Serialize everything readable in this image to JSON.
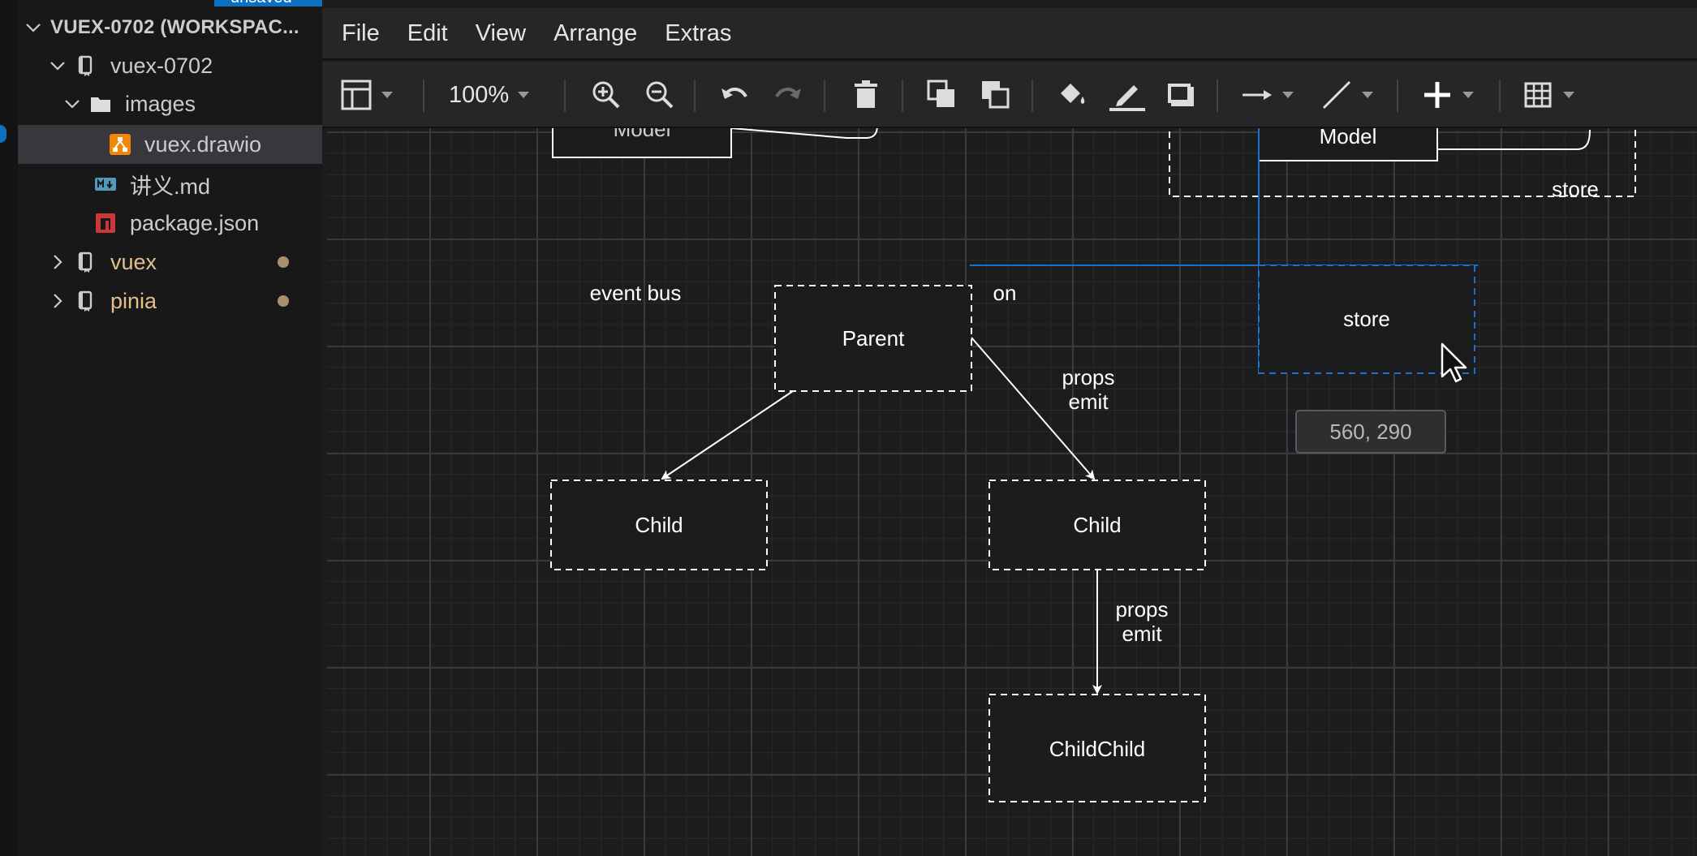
{
  "sidebar": {
    "unsaved_label": "unsaved",
    "workspace_title": "VUEX-0702 (WORKSPAC...",
    "items": [
      {
        "label": "vuex-0702",
        "type": "repo",
        "expanded": true
      },
      {
        "label": "images",
        "type": "folder",
        "expanded": true
      },
      {
        "label": "vuex.drawio",
        "type": "drawio-file",
        "selected": true
      },
      {
        "label": "讲义.md",
        "type": "markdown-file"
      },
      {
        "label": "package.json",
        "type": "npm-file"
      },
      {
        "label": "vuex",
        "type": "repo",
        "expanded": false,
        "modified": true
      },
      {
        "label": "pinia",
        "type": "repo",
        "expanded": false,
        "modified": true
      }
    ]
  },
  "menu": {
    "items": [
      "File",
      "Edit",
      "View",
      "Arrange",
      "Extras"
    ]
  },
  "toolbar": {
    "zoom": "100%",
    "tools": [
      "format-panel-icon",
      "zoom-in-icon",
      "zoom-out-icon",
      "undo-icon",
      "redo-icon",
      "delete-icon",
      "to-front-icon",
      "to-back-icon",
      "fill-color-icon",
      "line-color-icon",
      "shadow-icon",
      "connection-icon",
      "waypoints-icon",
      "insert-icon",
      "table-icon"
    ]
  },
  "diagram": {
    "nodes": {
      "top_left_partial": "Model",
      "model": "Model",
      "store_container_label": "store",
      "parent": "Parent",
      "store": "store",
      "child_left": "Child",
      "child_right": "Child",
      "childchild": "ChildChild"
    },
    "labels": {
      "event_bus": "event bus",
      "on": "on",
      "props_emit_1_line1": "props",
      "props_emit_1_line2": "emit",
      "props_emit_2_line1": "props",
      "props_emit_2_line2": "emit"
    },
    "coordinate_tooltip": "560, 290",
    "colors": {
      "canvas_bg": "#1c1c1e",
      "selection_blue": "#1a73c7",
      "node_stroke": "#ffffff"
    }
  }
}
